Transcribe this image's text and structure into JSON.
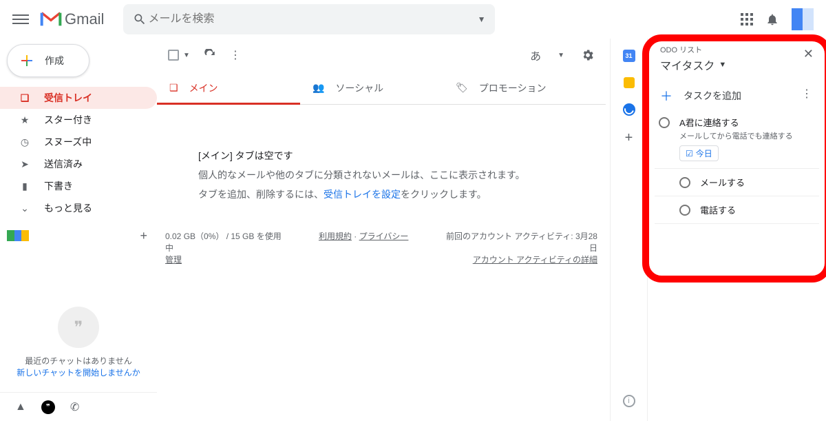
{
  "header": {
    "app_name": "Gmail",
    "search_placeholder": "メールを検索",
    "lang_indicator": "あ"
  },
  "compose_label": "作成",
  "sidebar": {
    "items": [
      {
        "label": "受信トレイ",
        "icon": "inbox"
      },
      {
        "label": "スター付き",
        "icon": "star"
      },
      {
        "label": "スヌーズ中",
        "icon": "clock"
      },
      {
        "label": "送信済み",
        "icon": "send"
      },
      {
        "label": "下書き",
        "icon": "file"
      },
      {
        "label": "もっと見る",
        "icon": "chevron-down"
      }
    ]
  },
  "chat": {
    "none": "最近のチャットはありません",
    "start": "新しいチャットを開始しませんか"
  },
  "tabs": [
    {
      "label": "メイン"
    },
    {
      "label": "ソーシャル"
    },
    {
      "label": "プロモーション"
    }
  ],
  "empty": {
    "title": "[メイン] タブは空です",
    "line1": "個人的なメールや他のタブに分類されないメールは、ここに表示されます。",
    "line2_a": "タブを追加、削除するには、",
    "line2_link": "受信トレイを設定",
    "line2_b": "をクリックします。"
  },
  "footer": {
    "storage_a": "0.02 GB（0%） / 15 GB を使用中",
    "storage_b": "管理",
    "terms": "利用規約",
    "privacy": "プライバシー",
    "activity_a": "前回のアカウント アクティビティ: 3月28日",
    "activity_link": "アカウント アクティビティの詳細"
  },
  "rail": {
    "cal_day": "31"
  },
  "tasks_panel": {
    "kicker": "ODO リスト",
    "list_name": "マイタスク",
    "add_label": "タスクを追加",
    "chip_label": "今日",
    "items": [
      {
        "title": "A君に連絡する",
        "sub": "メールしてから電話でも連絡する",
        "date": true
      },
      {
        "title": "メールする",
        "indent": true
      },
      {
        "title": "電話する",
        "indent": true
      }
    ]
  }
}
